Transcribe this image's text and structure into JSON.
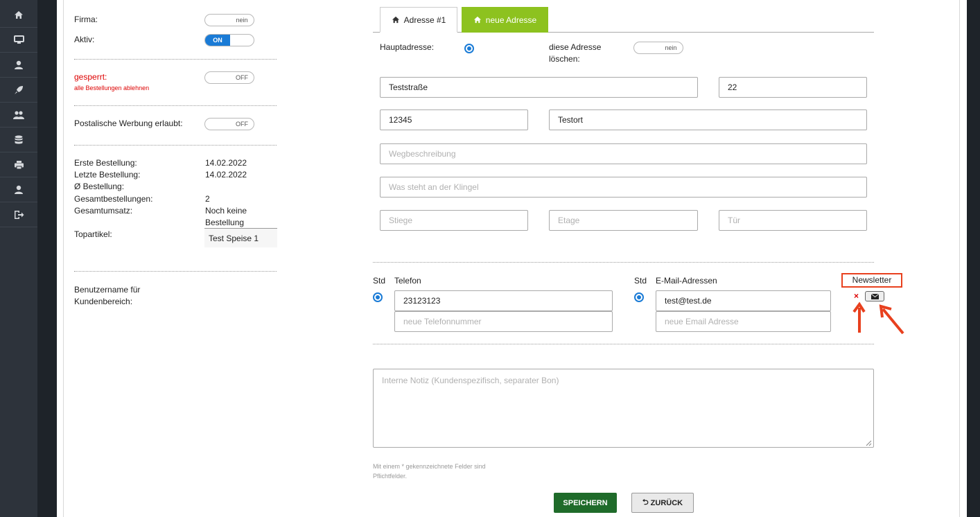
{
  "sidebar": {
    "items": [
      "home-icon",
      "monitor-icon",
      "user-icon",
      "rocket-icon",
      "users-icon",
      "database-icon",
      "printer-icon",
      "user-icon",
      "logout-icon"
    ]
  },
  "left": {
    "firma_label": "Firma:",
    "firma_toggle": "nein",
    "aktiv_label": "Aktiv:",
    "aktiv_on": "ON",
    "gesperrt_label": "gesperrt:",
    "gesperrt_sub": "alle Bestellungen ablehnen",
    "gesperrt_toggle": "OFF",
    "werbung_label": "Postalische Werbung erlaubt:",
    "werbung_toggle": "OFF",
    "stats": [
      {
        "label": "Erste Bestellung:",
        "value": "14.02.2022"
      },
      {
        "label": "Letzte Bestellung:",
        "value": "14.02.2022"
      },
      {
        "label": "Ø Bestellung:",
        "value": ""
      },
      {
        "label": "Gesamtbestellungen:",
        "value": "2"
      },
      {
        "label": "Gesamtumsatz:",
        "value": "Noch keine Bestellung"
      }
    ],
    "topartikel_label": "Topartikel:",
    "topartikel_value": "Test Speise 1",
    "benutzer_label": "Benutzername für Kundenbereich:"
  },
  "address": {
    "tab1": "Adresse #1",
    "tab2": "neue Adresse",
    "tab2_color": "#8dc21f",
    "haupt_label": "Hauptadresse:",
    "delete_label": "diese Adresse löschen:",
    "delete_toggle": "nein",
    "street": "Teststraße",
    "number": "22",
    "zip": "12345",
    "city": "Testort",
    "directions_ph": "Wegbeschreibung",
    "bell_ph": "Was steht an der Klingel",
    "stiege_ph": "Stiege",
    "etage_ph": "Etage",
    "tuer_ph": "Tür"
  },
  "contact": {
    "std_label": "Std",
    "phone_label": "Telefon",
    "phone": "23123123",
    "phone_new_ph": "neue Telefonnummer",
    "email_label": "E-Mail-Adressen",
    "email": "test@test.de",
    "email_new_ph": "neue Email Adresse",
    "newsletter_label": "Newsletter",
    "remove_mark": "×",
    "highlight_color": "#e8401e"
  },
  "note_ph": "Interne Notiz (Kundenspezifisch, separater Bon)",
  "required_hint": "Mit einem * gekennzeichnete Felder sind Pflichtfelder.",
  "buttons": {
    "save": "SPEICHERN",
    "save_color": "#1f6b2a",
    "back": "ZURÜCK",
    "back_icon": "⮌"
  }
}
